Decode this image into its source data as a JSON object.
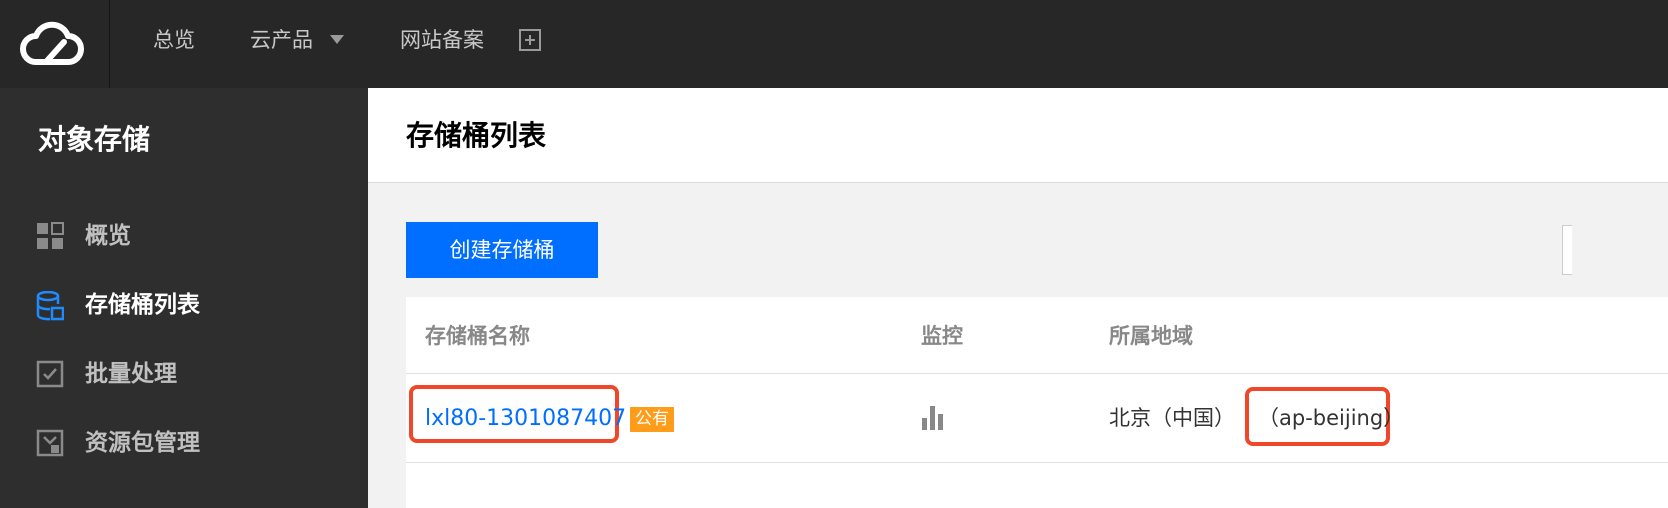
{
  "topnav": {
    "logo_icon": "cloud-logo-icon",
    "items": [
      {
        "label": "总览"
      },
      {
        "label": "云产品",
        "icon": "caret-down-icon"
      },
      {
        "label": "网站备案"
      }
    ],
    "plus_icon": "plus-square-icon"
  },
  "sidebar": {
    "title": "对象存储",
    "items": [
      {
        "label": "概览",
        "icon": "grid-icon",
        "active": false
      },
      {
        "label": "存储桶列表",
        "icon": "bucket-icon",
        "active": true
      },
      {
        "label": "批量处理",
        "icon": "checkbox-icon",
        "active": false
      },
      {
        "label": "资源包管理",
        "icon": "package-icon",
        "active": false
      }
    ]
  },
  "main": {
    "title": "存储桶列表",
    "create_button": "创建存储桶",
    "table": {
      "columns": [
        "存储桶名称",
        "监控",
        "所属地域"
      ],
      "rows": [
        {
          "name": "lxl80-1301087407",
          "badge": "公有",
          "monitor_icon": "bar-chart-icon",
          "region": "北京（中国）",
          "region_code": "（ap-beijing）"
        }
      ]
    }
  },
  "colors": {
    "topbar": "#272727",
    "sidebar": "#2e2e2e",
    "primary": "#006eff",
    "badge": "#ff9c19",
    "highlight": "#f0462a"
  }
}
